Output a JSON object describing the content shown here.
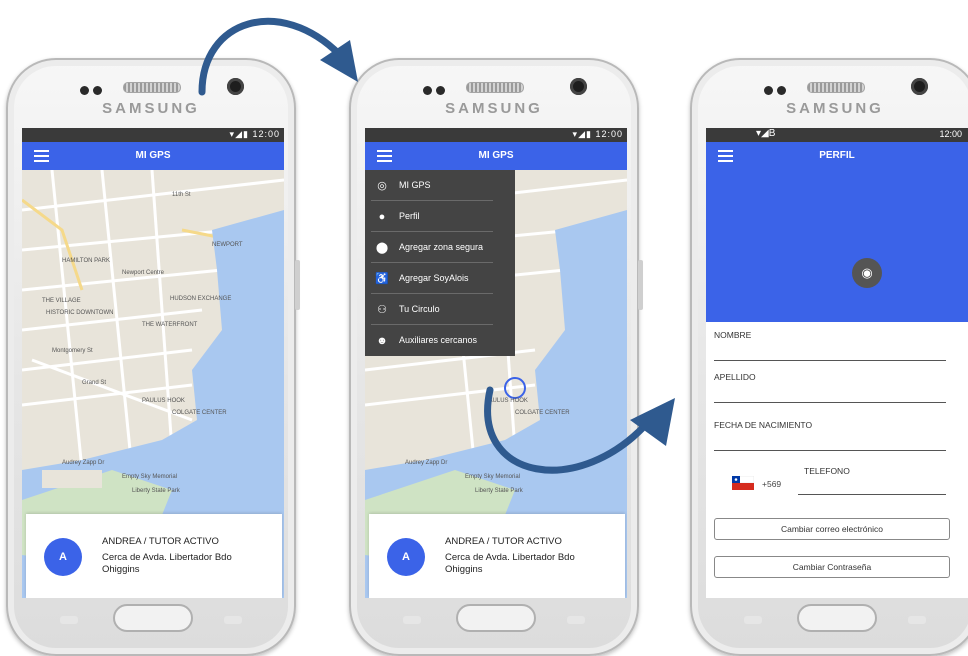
{
  "device": {
    "brand": "SAMSUNG"
  },
  "status": {
    "time": "12:00",
    "network": "▾◢▮",
    "left_icons": "▾◢B"
  },
  "screen1": {
    "title": "MI GPS",
    "map_labels": [
      "11th St",
      "HAMILTON PARK",
      "Newport Centre",
      "NEWPORT",
      "HUDSON EXCHANGE",
      "THE VILLAGE",
      "HISTORIC DOWNTOWN",
      "THE WATERFRONT",
      "Montgomery St",
      "Grand St",
      "PAULUS HOOK",
      "COLGATE CENTER",
      "Empty Sky Memorial",
      "Liberty State Park",
      "Audrey Zapp Dr"
    ],
    "card": {
      "avatar": "A",
      "name": "ANDREA / TUTOR ACTIVO",
      "address": "Cerca de Avda. Libertador Bdo Ohiggins"
    }
  },
  "screen2": {
    "title": "MI GPS",
    "menu": [
      {
        "icon": "gps-icon",
        "label": "MI GPS"
      },
      {
        "icon": "person-icon",
        "label": "Perfil"
      },
      {
        "icon": "location-pin-icon",
        "label": "Agregar zona segura"
      },
      {
        "icon": "walking-cane-icon",
        "label": "Agregar SoyAlois"
      },
      {
        "icon": "group-icon",
        "label": "Tu Circulo"
      },
      {
        "icon": "helper-icon",
        "label": "Auxiliares cercanos"
      }
    ],
    "map_labels": [
      "PAULUS HOOK",
      "COLGATE CENTER",
      "Empty Sky Memorial",
      "Liberty State Park",
      "Audrey Zapp Dr"
    ],
    "card": {
      "avatar": "A",
      "name": "ANDREA / TUTOR ACTIVO",
      "address": "Cerca de Avda. Libertador Bdo Ohiggins"
    }
  },
  "screen3": {
    "title": "PERFIL",
    "fields": [
      "NOMBRE",
      "APELLIDO",
      "FECHA DE NACIMIENTO"
    ],
    "phone_prefix": "+569",
    "phone_label": "TELEFONO",
    "buttons": [
      "Cambiar correo electrónico",
      "Cambiar Contraseña"
    ]
  },
  "colors": {
    "accent": "#3b63e8",
    "menu_bg": "#444444",
    "arrow": "#2f5a8f"
  }
}
